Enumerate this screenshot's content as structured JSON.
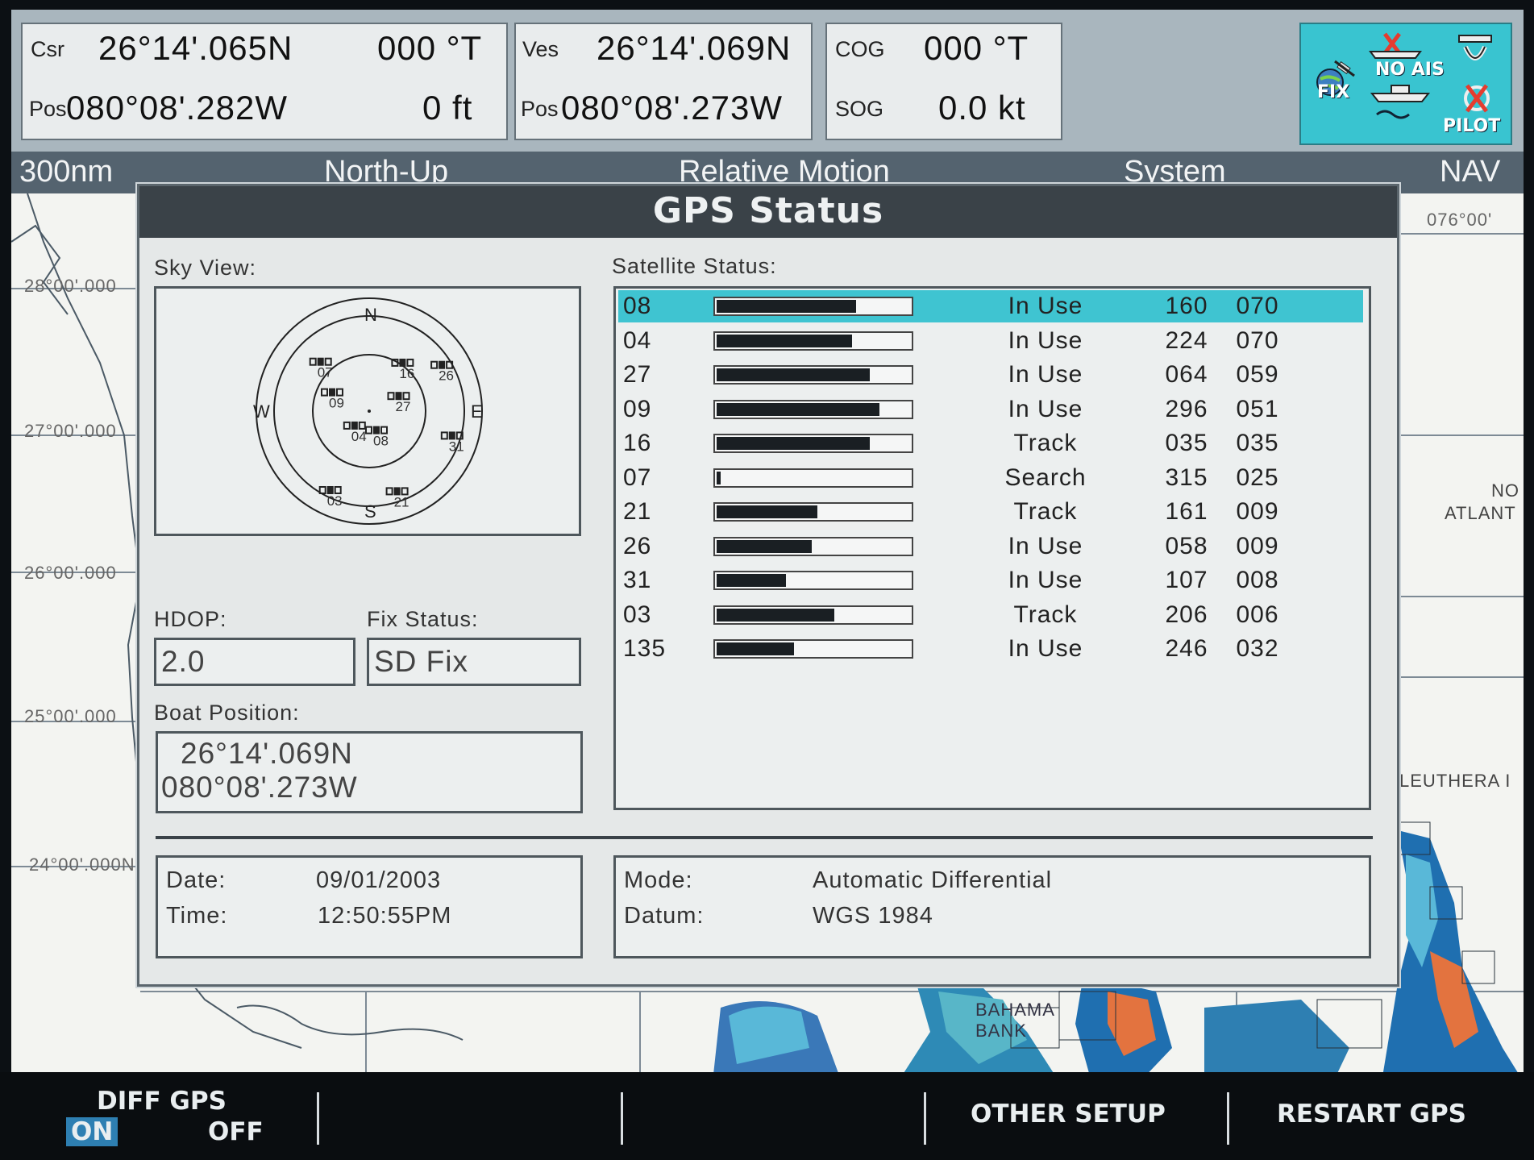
{
  "top_bar": {
    "cursor": {
      "label_top": "Csr",
      "label_bottom": "Pos",
      "lat": "26°14'.065N",
      "lon": "080°08'.282W",
      "bearing": "000 °T",
      "range": "0 ft"
    },
    "vessel": {
      "label_top": "Ves",
      "label_bottom": "Pos",
      "lat": "26°14'.069N",
      "lon": "080°08'.273W"
    },
    "cog": {
      "label": "COG",
      "value": "000 °T"
    },
    "sog": {
      "label": "SOG",
      "value": "0.0 kt"
    },
    "status_icons": {
      "fix": "FIX",
      "noais": "NO AIS",
      "pilot": "PILOT"
    }
  },
  "info_bar": {
    "range": "300nm",
    "orientation": "North-Up",
    "motion": "Relative Motion",
    "menu": "System",
    "mode": "NAV"
  },
  "chart_labels": {
    "lat_28": "28°00'.000",
    "lat_27": "27°00'.000",
    "lat_26": "26°00'.000",
    "lat_25": "25°00'.000",
    "lat_24": "24°00'.000N",
    "lon_76": "076°00'",
    "atlantic": "ATLANT",
    "north": "NO",
    "eleuthera": "LEUTHERA I",
    "bahama_bank": "BAHAMA BANK"
  },
  "dialog": {
    "title": "GPS Status",
    "sky_view_label": "Sky View:",
    "sky_view": {
      "cardinals": {
        "n": "N",
        "s": "S",
        "e": "E",
        "w": "W"
      },
      "satellites": [
        {
          "id": "07",
          "az": 315,
          "el": 25
        },
        {
          "id": "16",
          "az": 35,
          "el": 35
        },
        {
          "id": "26",
          "az": 58,
          "el": 9
        },
        {
          "id": "09",
          "az": 296,
          "el": 51
        },
        {
          "id": "27",
          "az": 64,
          "el": 59
        },
        {
          "id": "04",
          "az": 224,
          "el": 70
        },
        {
          "id": "08",
          "az": 160,
          "el": 70
        },
        {
          "id": "31",
          "az": 107,
          "el": 8
        },
        {
          "id": "03",
          "az": 206,
          "el": 6
        },
        {
          "id": "21",
          "az": 161,
          "el": 9
        }
      ]
    },
    "hdop_label": "HDOP:",
    "hdop": "2.0",
    "fix_status_label": "Fix Status:",
    "fix_status": "SD Fix",
    "boat_position_label": "Boat Position:",
    "boat_lat": "26°14'.069N",
    "boat_lon": "080°08'.273W",
    "satellite_status_label": "Satellite Status:",
    "satellites": [
      {
        "prn": "08",
        "signal": 0.72,
        "status": "In Use",
        "azimuth": "160",
        "elevation": "070"
      },
      {
        "prn": "04",
        "signal": 0.7,
        "status": "In Use",
        "azimuth": "224",
        "elevation": "070"
      },
      {
        "prn": "27",
        "signal": 0.79,
        "status": "In Use",
        "azimuth": "064",
        "elevation": "059"
      },
      {
        "prn": "09",
        "signal": 0.84,
        "status": "In Use",
        "azimuth": "296",
        "elevation": "051"
      },
      {
        "prn": "16",
        "signal": 0.79,
        "status": "Track",
        "azimuth": "035",
        "elevation": "035"
      },
      {
        "prn": "07",
        "signal": 0.02,
        "status": "Search",
        "azimuth": "315",
        "elevation": "025"
      },
      {
        "prn": "21",
        "signal": 0.52,
        "status": "Track",
        "azimuth": "161",
        "elevation": "009"
      },
      {
        "prn": "26",
        "signal": 0.49,
        "status": "In Use",
        "azimuth": "058",
        "elevation": "009"
      },
      {
        "prn": "31",
        "signal": 0.36,
        "status": "In Use",
        "azimuth": "107",
        "elevation": "008"
      },
      {
        "prn": "03",
        "signal": 0.61,
        "status": "Track",
        "azimuth": "206",
        "elevation": "006"
      },
      {
        "prn": "135",
        "signal": 0.4,
        "status": "In Use",
        "azimuth": "246",
        "elevation": "032"
      }
    ],
    "date_label": "Date:",
    "date": "09/01/2003",
    "time_label": "Time:",
    "time": "12:50:55PM",
    "mode_label": "Mode:",
    "mode": "Automatic Differential",
    "datum_label": "Datum:",
    "datum": "WGS 1984"
  },
  "softkeys": {
    "diff_gps": "DIFF GPS",
    "on": "ON",
    "off": "OFF",
    "other_setup": "OTHER SETUP",
    "restart_gps": "RESTART GPS"
  },
  "colors": {
    "highlight": "#3fc4d1",
    "title_bar": "#3a4248",
    "status_box": "#39c4d0"
  }
}
